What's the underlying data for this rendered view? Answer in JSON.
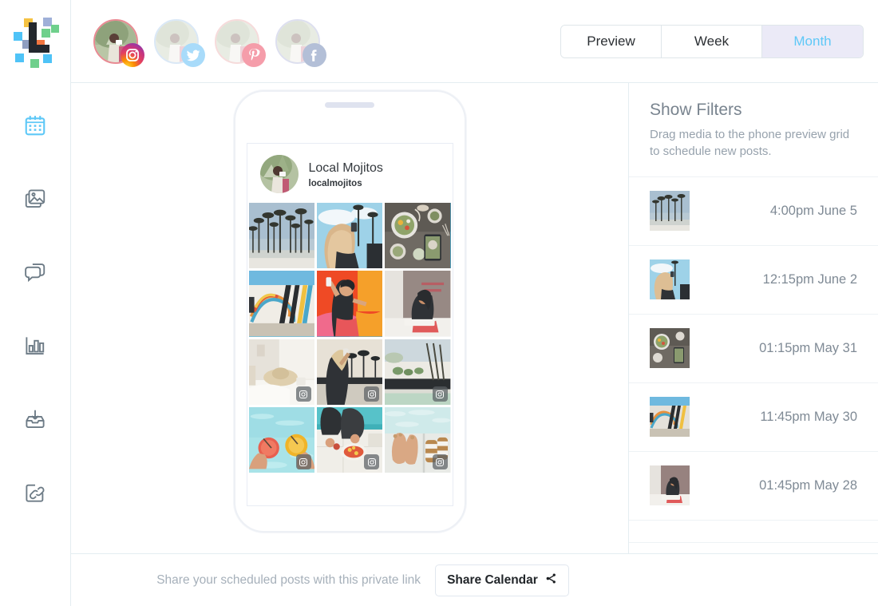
{
  "brand": {
    "logo_name": "later-logo",
    "accent": "#5ec8f7",
    "selected_border": "#41b6e6"
  },
  "topbar": {
    "accounts": [
      {
        "network": "instagram",
        "icon": "instagram-icon",
        "active": true
      },
      {
        "network": "twitter",
        "icon": "twitter-icon",
        "active": false
      },
      {
        "network": "pinterest",
        "icon": "pinterest-icon",
        "active": false
      },
      {
        "network": "facebook",
        "icon": "facebook-icon",
        "active": false
      }
    ],
    "view_tabs": [
      {
        "label": "Preview",
        "active": false
      },
      {
        "label": "Week",
        "active": false
      },
      {
        "label": "Month",
        "active": true
      }
    ]
  },
  "sidebar": {
    "items": [
      {
        "icon": "calendar-icon",
        "name": "sidebar-item-calendar",
        "active": true
      },
      {
        "icon": "media-library-icon",
        "name": "sidebar-item-media",
        "active": false
      },
      {
        "icon": "conversations-icon",
        "name": "sidebar-item-conversations",
        "active": false
      },
      {
        "icon": "analytics-icon",
        "name": "sidebar-item-analytics",
        "active": false
      },
      {
        "icon": "inbox-download-icon",
        "name": "sidebar-item-inbox",
        "active": false
      },
      {
        "icon": "link-in-bio-icon",
        "name": "sidebar-item-linkinbio",
        "active": false
      }
    ]
  },
  "phone": {
    "profile": {
      "name": "Local Mojitos",
      "handle": "localmojitos",
      "avatar": "profile-avatar"
    },
    "grid": [
      {
        "id": "palm-trees",
        "scheduled": true,
        "published": false
      },
      {
        "id": "blonde-phone",
        "scheduled": true,
        "published": false
      },
      {
        "id": "food-flatlay",
        "scheduled": true,
        "published": false
      },
      {
        "id": "mural-wall",
        "scheduled": true,
        "published": false
      },
      {
        "id": "orange-selfie",
        "scheduled": true,
        "published": false
      },
      {
        "id": "pink-wall-woman",
        "scheduled": false,
        "published": false
      },
      {
        "id": "bedroom-hat",
        "scheduled": false,
        "published": true
      },
      {
        "id": "palm-blonde-wall",
        "scheduled": false,
        "published": true
      },
      {
        "id": "pool-umbrellas",
        "scheduled": false,
        "published": true
      },
      {
        "id": "pool-drinks",
        "scheduled": false,
        "published": true
      },
      {
        "id": "poolside-fruit",
        "scheduled": false,
        "published": true
      },
      {
        "id": "feet-sandals",
        "scheduled": false,
        "published": true
      }
    ]
  },
  "panel": {
    "title": "Show Filters",
    "subtitle": "Drag media to the phone preview grid to schedule new posts.",
    "scheduled_posts": [
      {
        "thumb": "palm-trees",
        "time": "4:00pm June 5"
      },
      {
        "thumb": "blonde-phone",
        "time": "12:15pm June 2"
      },
      {
        "thumb": "food-flatlay",
        "time": "01:15pm May 31"
      },
      {
        "thumb": "mural-wall",
        "time": "11:45pm May 30"
      },
      {
        "thumb": "pink-wall-woman",
        "time": "01:45pm May 28"
      }
    ]
  },
  "footer": {
    "text": "Share your scheduled posts with this private link",
    "share_button": "Share Calendar",
    "share_icon": "share-nodes-icon"
  }
}
